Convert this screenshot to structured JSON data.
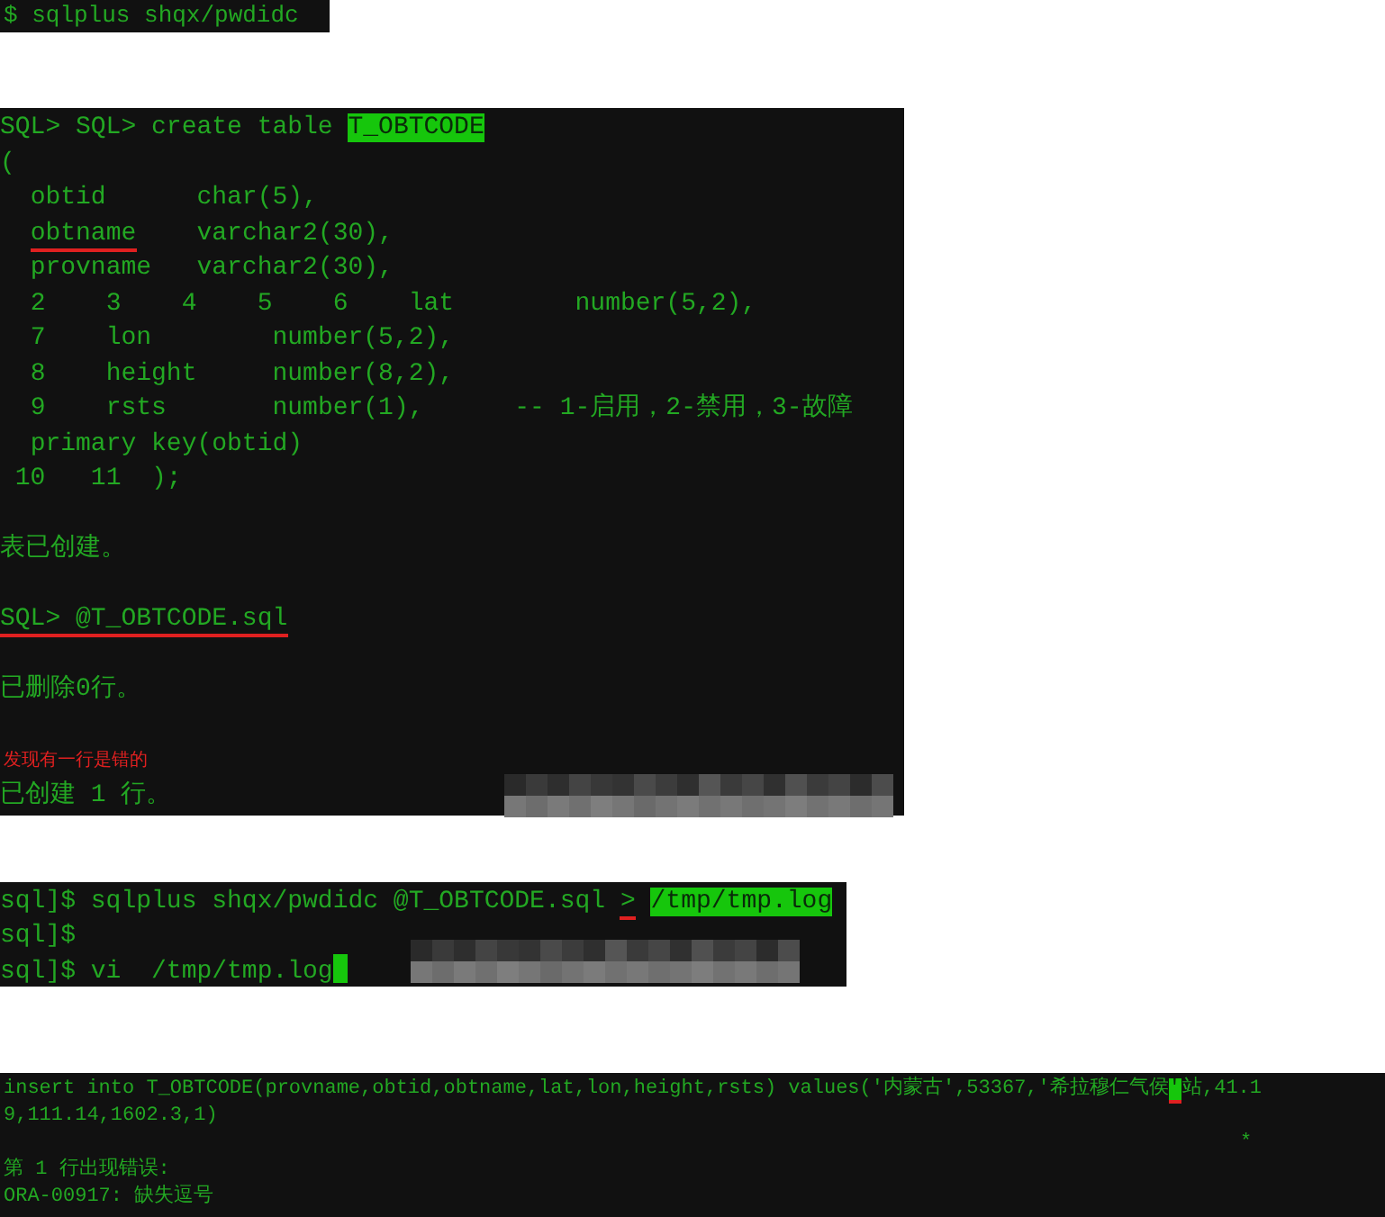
{
  "panels": [
    {
      "lines": [
        {
          "kind": "text",
          "segments": [
            {
              "text": "$ sqlplus shqx/pwdidc",
              "kind": "plain"
            }
          ]
        }
      ]
    },
    {
      "lines": [
        {
          "kind": "text",
          "segments": [
            {
              "text": "SQL> SQL> create table ",
              "kind": "plain"
            },
            {
              "text": "T_OBTCODE",
              "kind": "highlight"
            }
          ]
        },
        {
          "kind": "text",
          "segments": [
            {
              "text": "(",
              "kind": "plain"
            }
          ]
        },
        {
          "kind": "text",
          "segments": [
            {
              "text": "  obtid      char(5),",
              "kind": "plain"
            }
          ]
        },
        {
          "kind": "text",
          "segments": [
            {
              "text": "  obtname",
              "kind": "underline"
            },
            {
              "text": "    varchar2(30),",
              "kind": "plain"
            }
          ]
        },
        {
          "kind": "text",
          "segments": [
            {
              "text": "  provname   varchar2(30),",
              "kind": "plain"
            }
          ]
        },
        {
          "kind": "text",
          "segments": [
            {
              "text": "  2    3    4    5    6    lat        number(5,2),",
              "kind": "plain"
            }
          ]
        },
        {
          "kind": "text",
          "segments": [
            {
              "text": "  7    lon        number(5,2),",
              "kind": "plain"
            }
          ]
        },
        {
          "kind": "text",
          "segments": [
            {
              "text": "  8    height     number(8,2),",
              "kind": "plain"
            }
          ]
        },
        {
          "kind": "text",
          "segments": [
            {
              "text": "  9    rsts       number(1),      -- 1-启用，2-禁用，3-故障",
              "kind": "plain"
            }
          ]
        },
        {
          "kind": "text",
          "segments": [
            {
              "text": "  primary key(obtid)",
              "kind": "plain"
            }
          ]
        },
        {
          "kind": "text",
          "segments": [
            {
              "text": " 10   11  );",
              "kind": "plain"
            }
          ]
        },
        {
          "kind": "blank"
        },
        {
          "kind": "text",
          "segments": [
            {
              "text": "表已创建。",
              "kind": "plain"
            }
          ]
        },
        {
          "kind": "blank"
        },
        {
          "kind": "text",
          "segments": [
            {
              "text": "SQL> @T_OBTCODE.sql",
              "kind": "underline"
            }
          ]
        },
        {
          "kind": "blank"
        },
        {
          "kind": "text",
          "segments": [
            {
              "text": "已删除0行。",
              "kind": "plain"
            }
          ]
        },
        {
          "kind": "blank"
        },
        {
          "kind": "note",
          "segments": [
            {
              "text": "发现有一行是错的"
            }
          ]
        },
        {
          "kind": "text",
          "segments": [
            {
              "text": "已创建 1 行。",
              "kind": "plain"
            }
          ]
        }
      ]
    },
    {
      "lines": [
        {
          "kind": "text",
          "segments": [
            {
              "text": "sql]$ sqlplus shqx/pwdidc @T_OBTCODE.sql ",
              "kind": "plain"
            },
            {
              "text": ">",
              "kind": "underline"
            },
            {
              "text": " /tmp/tmp.log",
              "kind": "highlight"
            }
          ]
        },
        {
          "kind": "text",
          "segments": [
            {
              "text": "sql]$",
              "kind": "plain"
            }
          ]
        },
        {
          "kind": "text_cursor",
          "segments": [
            {
              "text": "sql]$ vi  /tmp/tmp.log",
              "kind": "plain"
            }
          ]
        }
      ]
    },
    {
      "lines": [
        {
          "kind": "text",
          "segments": [
            {
              "text": "insert into T_OBTCODE(provname,obtid,obtname,lat,lon,height,rsts) values('内蒙古',53367,'希拉穆仁气侯",
              "kind": "plain"
            },
            {
              "text": "'",
              "kind": "highlight_underline"
            },
            {
              "text": "站,41.1",
              "kind": "plain"
            }
          ]
        },
        {
          "kind": "text",
          "segments": [
            {
              "text": "9,111.14,1602.3,1)",
              "kind": "plain"
            }
          ]
        },
        {
          "kind": "text",
          "segments": [
            {
              "text": "                                                                                                        *",
              "kind": "plain"
            }
          ]
        },
        {
          "kind": "text",
          "segments": [
            {
              "text": "第 1 行出现错误:",
              "kind": "plain"
            }
          ]
        },
        {
          "kind": "text",
          "segments": [
            {
              "text": "ORA-00917: 缺失逗号",
              "kind": "plain"
            }
          ]
        }
      ]
    }
  ]
}
